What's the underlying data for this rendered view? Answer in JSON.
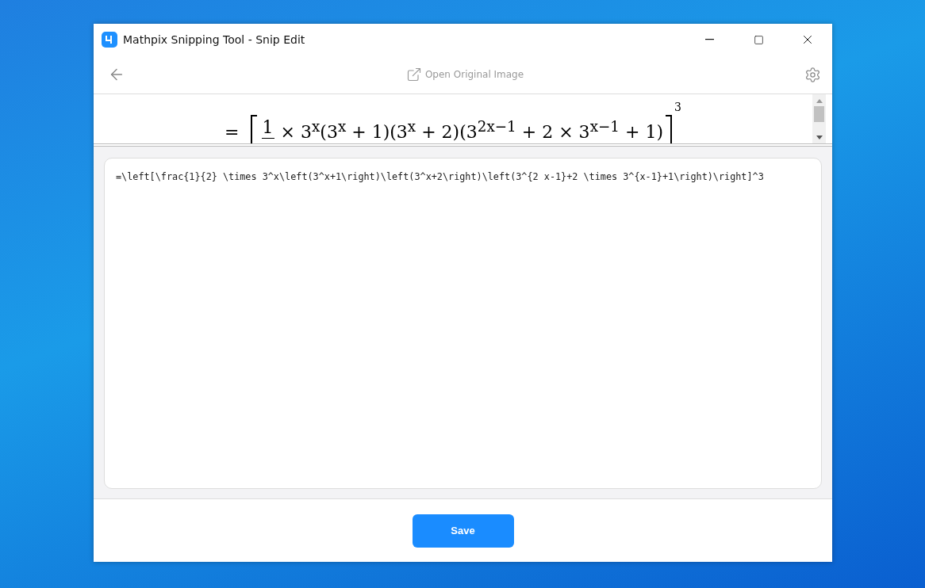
{
  "window": {
    "title": "Mathpix Snipping Tool - Snip Edit"
  },
  "toolbar": {
    "open_original": "Open Original Image"
  },
  "math_preview": {
    "lhs": "=",
    "fraction_numerator": "1",
    "body": "× 3$^{x}$(3$^{x}$ + 1)(3$^{x}$ + 2)(3$^{2x−1}$ + 2 × 3$^{x−1}$ + 1)",
    "exponent": "3"
  },
  "editor": {
    "value": "=\\left[\\frac{1}{2} \\times 3^x\\left(3^x+1\\right)\\left(3^x+2\\right)\\left(3^{2 x-1}+2 \\times 3^{x-1}+1\\right)\\right]^3"
  },
  "buttons": [
    {
      "label": "Save"
    }
  ]
}
